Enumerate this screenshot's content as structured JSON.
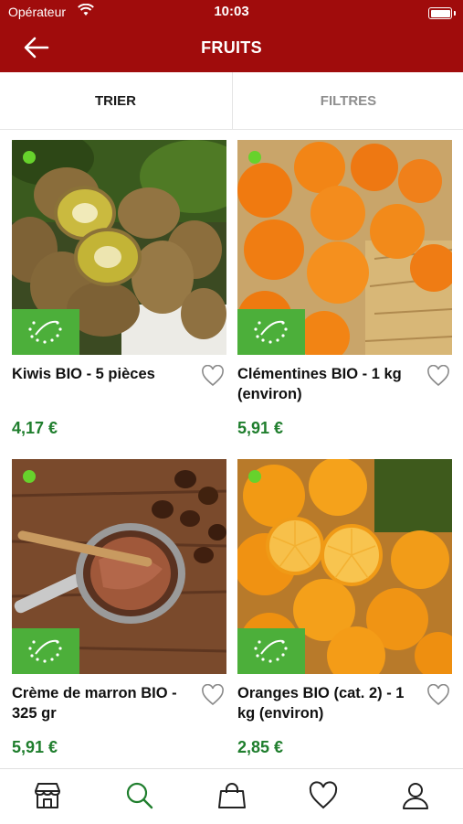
{
  "status_bar": {
    "carrier": "Opérateur",
    "time": "10:03"
  },
  "header": {
    "title": "FRUITS",
    "back_icon": "arrow-left-icon"
  },
  "tabs": {
    "sort_label": "TRIER",
    "filter_label": "FILTRES"
  },
  "colors": {
    "brand_red": "#a00c0c",
    "price_green": "#1f7e2d",
    "bio_green": "#4caf3a",
    "availability_dot": "#67d22c"
  },
  "products": [
    {
      "name": "Kiwis BIO -  5 pièces",
      "price": "4,17 €",
      "image": "kiwis-photo",
      "bio_label": true
    },
    {
      "name": "Clémentines BIO - 1 kg (environ)",
      "price": "5,91 €",
      "image": "clementines-photo",
      "bio_label": true
    },
    {
      "name": "Crème de marron BIO - 325 gr",
      "price": "5,91 €",
      "image": "chestnut-cream-photo",
      "bio_label": true
    },
    {
      "name": "Oranges BIO (cat. 2) - 1 kg (environ)",
      "price": "2,85 €",
      "image": "oranges-photo",
      "bio_label": true
    }
  ],
  "tab_bar": {
    "icons": [
      "shop-icon",
      "search-icon",
      "bag-icon",
      "heart-icon",
      "user-icon"
    ],
    "active": "search-icon"
  }
}
